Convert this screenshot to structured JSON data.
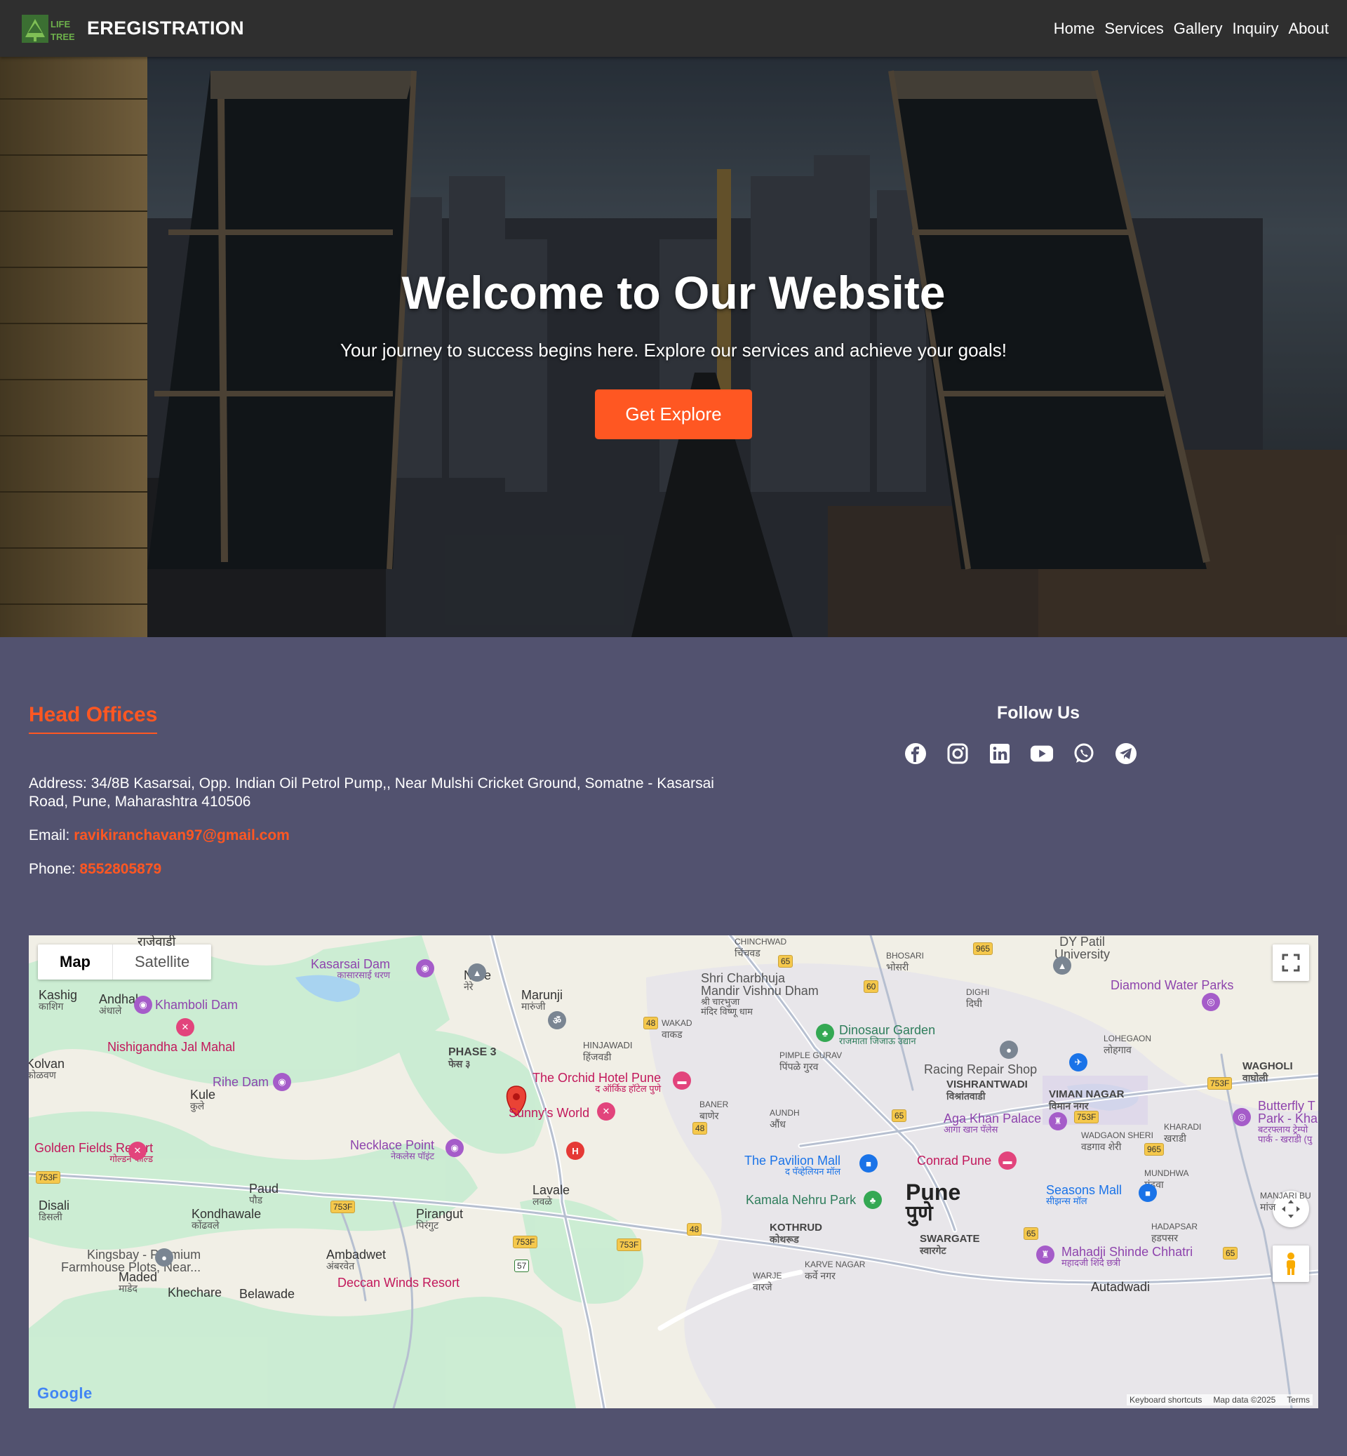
{
  "brand": {
    "logo_text": "LIFE TREE",
    "name": "EREGISTRATION"
  },
  "nav": {
    "items": [
      "Home",
      "Services",
      "Gallery",
      "Inquiry",
      "About"
    ]
  },
  "hero": {
    "title": "Welcome to Our Website",
    "subtitle": "Your journey to success begins here. Explore our services and achieve your goals!",
    "button": "Get Explore"
  },
  "offices": {
    "heading": "Head Offices",
    "address_label": "Address:",
    "address": "34/8B Kasarsai, Opp. Indian Oil Petrol Pump,, Near Mulshi Cricket Ground, Somatne - Kasarsai Road, Pune, Maharashtra 410506",
    "email_label": "Email:",
    "email": "ravikiranchavan97@gmail.com",
    "phone_label": "Phone:",
    "phone": "8552805879"
  },
  "follow": {
    "heading": "Follow Us",
    "icons": [
      "facebook-icon",
      "instagram-icon",
      "linkedin-icon",
      "youtube-icon",
      "whatsapp-icon",
      "telegram-icon"
    ]
  },
  "map": {
    "type_map": "Map",
    "type_satellite": "Satellite",
    "logo": "Google",
    "shortcuts": "Keyboard shortcuts",
    "data": "Map data ©2025",
    "terms": "Terms",
    "labels": {
      "rajewadi": "राजेवाडी",
      "kashig": "Kashig",
      "kashig_mr": "काशिग",
      "andhale": "Andhale",
      "andhale_mr": "अंधाले",
      "kolvan": "Kolvan",
      "kolvan_mr": "कोळवण",
      "kule": "Kule",
      "kule_mr": "कुले",
      "nere": "Nere",
      "nere_mr": "नेरे",
      "marunji": "Marunji",
      "marunji_mr": "मारुंजी",
      "phase3": "PHASE 3",
      "phase3_mr": "फेस ३",
      "hinjawadi": "HINJAWADI",
      "hinjawadi_mr": "हिंजवडी",
      "wakad": "WAKAD",
      "wakad_mr": "वाकड",
      "chinchwad": "CHINCHWAD",
      "chinchwad_mr": "चिंचवड",
      "bhosari": "BHOSARI",
      "bhosari_mr": "भोसरी",
      "dighi": "DIGHI",
      "dighi_mr": "दिघी",
      "lohegaon": "LOHEGAON",
      "lohegaon_mr": "लोहगाव",
      "pimple": "PIMPLE GURAV",
      "pimple_mr": "पिंपळे गुरव",
      "vishrantwadi": "VISHRANTWADI",
      "vishrantwadi_mr": "विश्रांतवाडी",
      "viman": "VIMAN NAGAR",
      "viman_mr": "विमान नगर",
      "wagholi": "WAGHOLI",
      "wagholi_mr": "वाघोली",
      "kharadi": "KHARADI",
      "kharadi_mr": "खराडी",
      "wadgaon": "WADGAON SHERI",
      "wadgaon_mr": "वडगाव शेरी",
      "mundhwa": "MUNDHWA",
      "mundhwa_mr": "मुंढवा",
      "manjari": "MANJARI BU",
      "manjari_mr": "मांज",
      "hadapsar": "HADAPSAR",
      "hadapsar_mr": "हडपसर",
      "baner": "BANER",
      "baner_mr": "बाणेर",
      "aundh": "AUNDH",
      "aundh_mr": "औंध",
      "pune": "Pune",
      "pune_mr": "पुणे",
      "kothrud": "KOTHRUD",
      "kothrud_mr": "कोथरूड",
      "swargate": "SWARGATE",
      "swargate_mr": "स्वारगेट",
      "karve": "KARVE NAGAR",
      "karve_mr": "कर्वे नगर",
      "warje": "WARJE",
      "warje_mr": "वारजे",
      "lavale": "Lavale",
      "lavale_mr": "लवळे",
      "pirangut": "Pirangut",
      "pirangut_mr": "पिरंगुट",
      "paud": "Paud",
      "paud_mr": "पौड",
      "disali": "Disali",
      "disali_mr": "डिसली",
      "kondhawale": "Kondhawale",
      "kondhawale_mr": "कोंढवले",
      "ambadwet": "Ambadwet",
      "ambadwet_mr": "अंबरवेत",
      "maded": "Maded",
      "maded_mr": "माडेद",
      "khechare": "Khechare",
      "belawade": "Belawade",
      "autadwadi": "Autadwadi",
      "dypatil": "DY Patil",
      "dypatil2": "University"
    },
    "pois": {
      "kasarsai_dam": "Kasarsai Dam",
      "kasarsai_dam_mr": "कासारसाई धरण",
      "khamboli_dam": "Khamboli Dam",
      "nishigandha": "Nishigandha Jal Mahal",
      "rihe_dam": "Rihe Dam",
      "shri_charbhuja": "Shri Charbhuja",
      "shri_charbhuja2": "Mandir Vishnu Dham",
      "shri_charbhuja_mr": "श्री चारभुजा",
      "shri_charbhuja_mr2": "मंदिर विष्णू धाम",
      "dinosaur": "Dinosaur Garden",
      "dinosaur_mr": "राजमाता जिजाऊ उद्यान",
      "diamond": "Diamond Water Parks",
      "racing": "Racing Repair Shop",
      "orchid": "The Orchid Hotel Pune",
      "orchid_mr": "द ऑर्किड हॉटेल पुणे",
      "sunny": "Sunny's World",
      "golden": "Golden Fields Resort",
      "golden_mr": "गोल्डन फील्ड",
      "necklace": "Necklace Point",
      "necklace_mr": "नेकलेस पॉइंट",
      "aga_khan": "Aga Khan Palace",
      "aga_khan_mr": "आगा खान पॅलेस",
      "butterfly": "Butterfly T",
      "butterfly2": "Park - Kha",
      "butterfly_mr": "बटरफ्लाय ट्रेम्पो",
      "butterfly_mr2": "पार्क - खराडी (पु",
      "pavilion": "The Pavilion Mall",
      "pavilion_mr": "द पॅव्हेलियन मॉल",
      "conrad": "Conrad Pune",
      "kamala": "Kamala Nehru Park",
      "seasons": "Seasons Mall",
      "seasons_mr": "सीझन्स मॉल",
      "mahadji": "Mahadji Shinde Chhatri",
      "mahadji_mr": "महादजी शिंदे छत्री",
      "kingsbay": "Kingsbay - Premium",
      "kingsbay2": "Farmhouse Plots, Near...",
      "deccan": "Deccan Winds Resort"
    },
    "roads": {
      "r965a": "965",
      "r65a": "65",
      "r60": "60",
      "r48a": "48",
      "r753f_a": "753F",
      "r65b": "65",
      "r753f_b": "753F",
      "r48b": "48",
      "r965b": "965",
      "r753f_c": "753F",
      "r753f_d": "753F",
      "r48c": "48",
      "r753f_e": "753F",
      "r753f_f": "753F",
      "r65c": "65",
      "r65d": "65",
      "r57": "57"
    }
  },
  "colors": {
    "accent": "#ff5722",
    "navbar": "#2f2f2f",
    "footer_bg": "#52526f"
  }
}
